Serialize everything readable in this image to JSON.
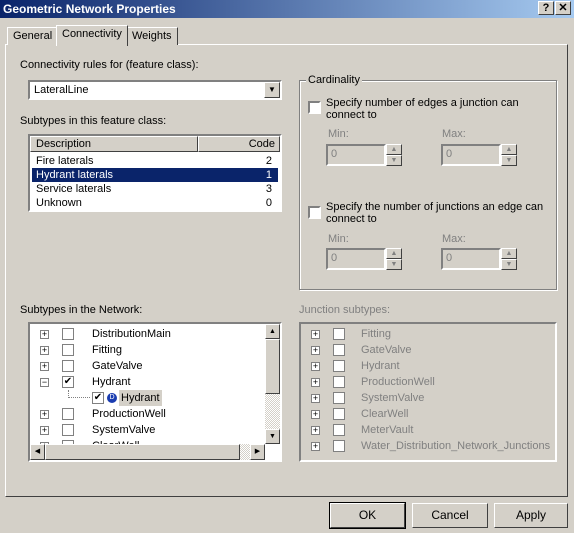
{
  "window": {
    "title": "Geometric Network Properties",
    "help": "?",
    "close": "✕"
  },
  "tabs": [
    {
      "label": "General"
    },
    {
      "label": "Connectivity",
      "selected": true
    },
    {
      "label": "Weights"
    }
  ],
  "connectivity": {
    "rules_label": "Connectivity rules for (feature class):",
    "feature_class": "LateralLine",
    "subtypes_label": "Subtypes in this feature class:",
    "columns": [
      "Description",
      "Code"
    ],
    "subtypes": [
      {
        "description": "Fire laterals",
        "code": "2"
      },
      {
        "description": "Hydrant laterals",
        "code": "1",
        "selected": true
      },
      {
        "description": "Service laterals",
        "code": "3"
      },
      {
        "description": "Unknown",
        "code": "0"
      }
    ],
    "cardinality": {
      "title": "Cardinality",
      "edges_check": "Specify number of edges a junction can connect to",
      "junctions_check": "Specify the number of junctions an edge can connect to",
      "min_label": "Min:",
      "max_label": "Max:",
      "edges_min": "0",
      "edges_max": "0",
      "junctions_min": "0",
      "junctions_max": "0"
    },
    "network_label": "Subtypes in the Network:",
    "network_tree": [
      {
        "label": "DistributionMain",
        "checked": false
      },
      {
        "label": "Fitting",
        "checked": false
      },
      {
        "label": "GateValve",
        "checked": false
      },
      {
        "label": "Hydrant",
        "checked": true,
        "expanded": true
      },
      {
        "label": "Hydrant",
        "checked": true,
        "child": true,
        "default": true
      },
      {
        "label": "ProductionWell",
        "checked": false
      },
      {
        "label": "SystemValve",
        "checked": false
      },
      {
        "label": "ClearWell",
        "checked": false
      }
    ],
    "junction_label": "Junction subtypes:",
    "junction_tree": [
      "Fitting",
      "GateValve",
      "Hydrant",
      "ProductionWell",
      "SystemValve",
      "ClearWell",
      "MeterVault",
      "Water_Distribution_Network_Junctions"
    ]
  },
  "buttons": {
    "ok": "OK",
    "cancel": "Cancel",
    "apply": "Apply"
  },
  "colors": {
    "titlebar_start": "#0a246a",
    "titlebar_end": "#a6caf0",
    "selection": "#0a246a",
    "face": "#d4d0c8"
  }
}
